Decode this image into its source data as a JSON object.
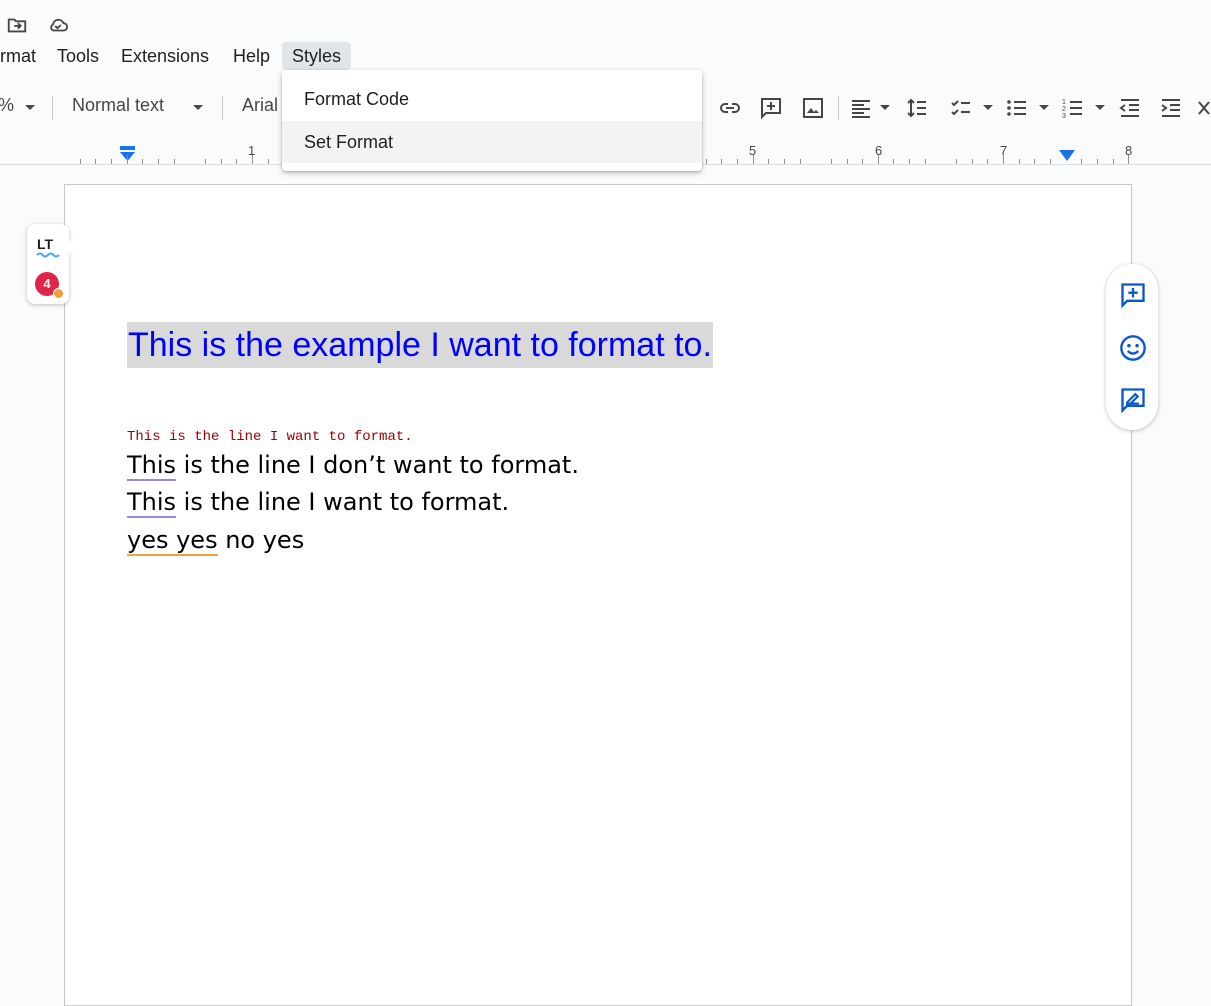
{
  "menu": {
    "items": [
      {
        "label": "rmat"
      },
      {
        "label": "Tools"
      },
      {
        "label": "Extensions"
      },
      {
        "label": "Help"
      },
      {
        "label": "Styles"
      }
    ]
  },
  "toolbar": {
    "zoom_fragment": "%",
    "paragraph_style": "Normal text",
    "font_fragment": "Arial"
  },
  "ruler": {
    "numbers": [
      "1",
      "5",
      "6",
      "7",
      "8"
    ]
  },
  "dropdown": {
    "items": [
      {
        "label": "Format Code"
      },
      {
        "label": "Set Format"
      }
    ]
  },
  "lt_widget": {
    "logo_text": "LT",
    "badge_count": "4"
  },
  "document": {
    "heading": "This is the example I want to format to.",
    "code_line": "This is the line I want to format.",
    "line2_first": "This",
    "line2_rest": " is the line I don’t want to format.",
    "line3_first": "This",
    "line3_rest": " is the line I want to format.",
    "line4_first": "yes yes",
    "line4_rest": " no yes"
  },
  "colors": {
    "heading_text": "#0000ff",
    "heading_highlight": "#d9d9d9",
    "code_text": "#990000",
    "accent_blue": "#0b57d0",
    "badge_red": "#e0244a"
  }
}
